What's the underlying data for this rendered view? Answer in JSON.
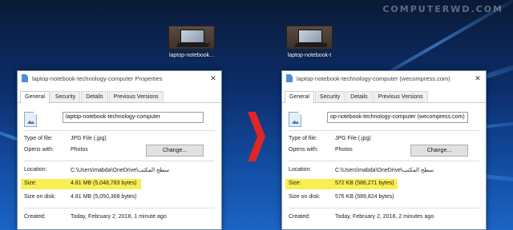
{
  "watermark": "COMPUTERWD.COM",
  "desktop_icons": [
    {
      "caption": "laptop-notebook...",
      "icon": "jpg-thumbnail-icon"
    },
    {
      "caption": "laptop-notebook-t",
      "icon": "jpg-thumbnail-icon"
    }
  ],
  "colors": {
    "highlight": "#f9ee52",
    "arrow": "#e22424",
    "accent": "#0b5fc3"
  },
  "left": {
    "title": "laptop-notebook-technology-computer Properties",
    "close": "✕",
    "tabs": [
      "General",
      "Security",
      "Details",
      "Previous Versions"
    ],
    "filename": "laptop-notebook-technology-computer",
    "type_label": "Type of file:",
    "type_value": "JPG File (.jpg)",
    "opens_label": "Opens with:",
    "opens_value": "Photos",
    "change_button": "Change...",
    "location_label": "Location:",
    "location_value": "C:\\Users\\mabda\\OneDrive\\سطح المكتب",
    "size_label": "Size:",
    "size_value": "4.81 MB (5,048,783 bytes)",
    "disk_label": "Size on disk:",
    "disk_value": "4.81 MB (5,050,368 bytes)",
    "created_label": "Created:",
    "created_value": "Today, February 2, 2018, 1 minute ago"
  },
  "right": {
    "title": "laptop-notebook-technology-computer (wecompress.com)",
    "close": "✕",
    "tabs": [
      "General",
      "Security",
      "Details",
      "Previous Versions"
    ],
    "filename": "op-notebook-technology-computer (wecompress.com)",
    "type_label": "Type of file:",
    "type_value": "JPG File (.jpg)",
    "opens_label": "Opens with:",
    "opens_value": "Photos",
    "change_button": "Change...",
    "location_label": "Location:",
    "location_value": "C:\\Users\\mabda\\OneDrive\\سطح المكتب",
    "size_label": "Size:",
    "size_value": "572 KB (586,271 bytes)",
    "disk_label": "Size on disk:",
    "disk_value": "576 KB (589,824 bytes)",
    "created_label": "Created:",
    "created_value": "Today, February 2, 2018, 2 minutes ago"
  }
}
